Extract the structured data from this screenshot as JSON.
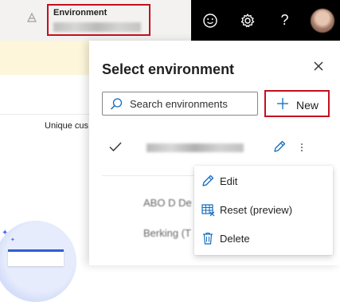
{
  "header": {
    "environment_label": "Environment",
    "icons": [
      "smiley-icon",
      "gear-icon",
      "help-icon",
      "avatar"
    ],
    "help_glyph": "?"
  },
  "background": {
    "column_text": "Unique cus"
  },
  "panel": {
    "title": "Select environment",
    "search_placeholder": "Search environments",
    "new_button_label": "New",
    "environments": [
      {
        "current": true,
        "name_visible": false
      },
      {
        "partial_text": "ABO D De"
      },
      {
        "partial_text": "Berking (T"
      }
    ]
  },
  "context_menu": {
    "items": [
      {
        "label": "Edit",
        "icon": "pencil-icon"
      },
      {
        "label": "Reset (preview)",
        "icon": "table-reset-icon"
      },
      {
        "label": "Delete",
        "icon": "trash-icon"
      }
    ]
  },
  "colors": {
    "highlight_border": "#c50f1f",
    "dark_bar": "#000000",
    "accent": "#0f6cbd",
    "banner": "#fdf6da"
  }
}
